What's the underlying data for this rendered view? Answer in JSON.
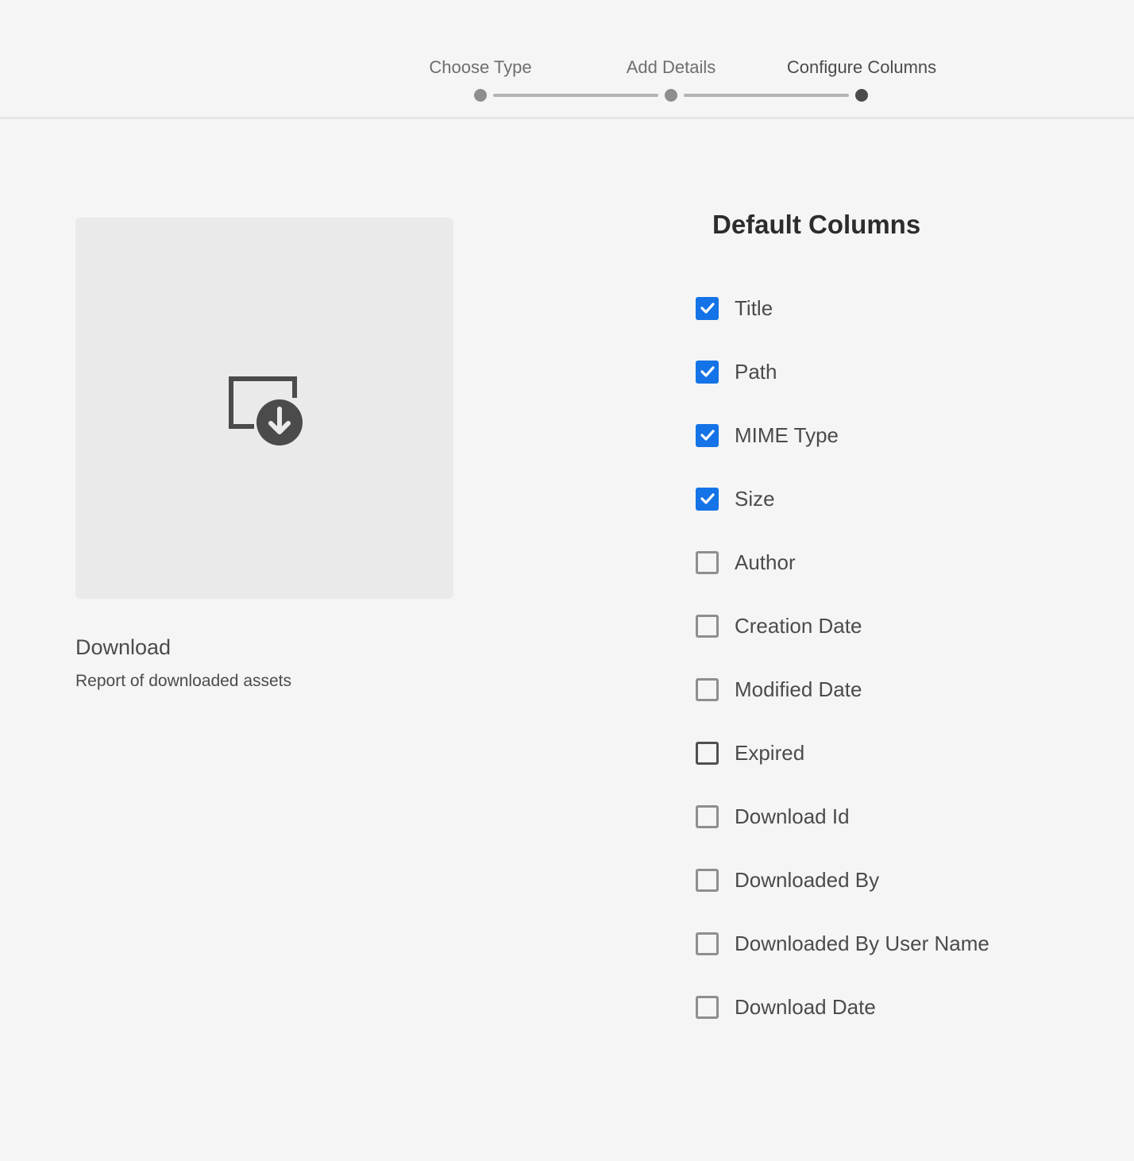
{
  "steps": [
    {
      "label": "Choose Type",
      "state": "done"
    },
    {
      "label": "Add Details",
      "state": "done"
    },
    {
      "label": "Configure Columns",
      "state": "current"
    }
  ],
  "card": {
    "icon": "download-report-icon",
    "title": "Download",
    "description": "Report of downloaded assets"
  },
  "columns_section": {
    "title": "Default Columns",
    "items": [
      {
        "label": "Title",
        "checked": true
      },
      {
        "label": "Path",
        "checked": true
      },
      {
        "label": "MIME Type",
        "checked": true
      },
      {
        "label": "Size",
        "checked": true
      },
      {
        "label": "Author",
        "checked": false
      },
      {
        "label": "Creation Date",
        "checked": false
      },
      {
        "label": "Modified Date",
        "checked": false
      },
      {
        "label": "Expired",
        "checked": false
      },
      {
        "label": "Download Id",
        "checked": false
      },
      {
        "label": "Downloaded By",
        "checked": false
      },
      {
        "label": "Downloaded By User Name",
        "checked": false
      },
      {
        "label": "Download Date",
        "checked": false
      }
    ]
  },
  "colors": {
    "accent": "#1473e6",
    "background": "#f5f5f5",
    "thumbnail": "#eaeaea"
  }
}
